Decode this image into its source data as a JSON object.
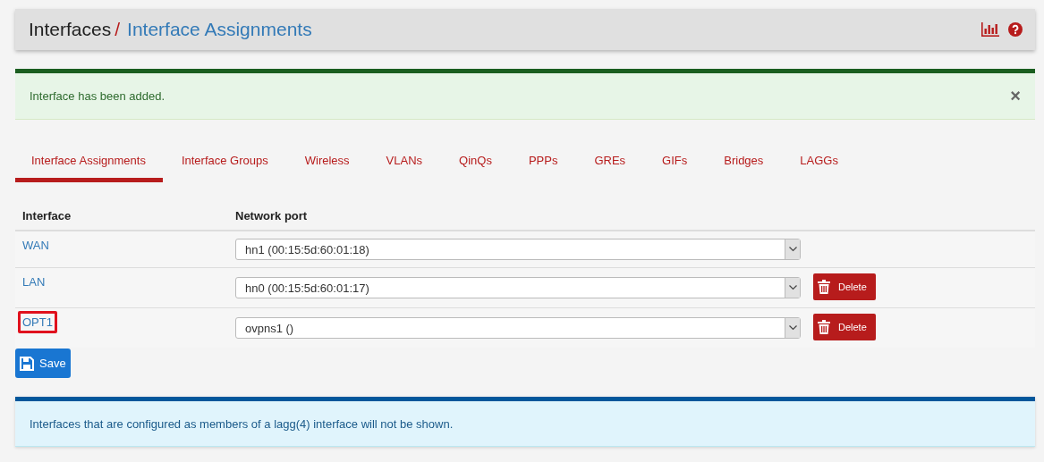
{
  "breadcrumb": {
    "parent": "Interfaces",
    "separator": "/",
    "current": "Interface Assignments"
  },
  "alert": {
    "message": "Interface has been added.",
    "close": "×"
  },
  "tabs": [
    {
      "label": "Interface Assignments",
      "selected": true
    },
    {
      "label": "Interface Groups",
      "selected": false
    },
    {
      "label": "Wireless",
      "selected": false
    },
    {
      "label": "VLANs",
      "selected": false
    },
    {
      "label": "QinQs",
      "selected": false
    },
    {
      "label": "PPPs",
      "selected": false
    },
    {
      "label": "GREs",
      "selected": false
    },
    {
      "label": "GIFs",
      "selected": false
    },
    {
      "label": "Bridges",
      "selected": false
    },
    {
      "label": "LAGGs",
      "selected": false
    }
  ],
  "table": {
    "columns": [
      "Interface",
      "Network port"
    ],
    "rows": [
      {
        "interface": "WAN",
        "port": "hn1 (00:15:5d:60:01:18)",
        "delete": null,
        "highlighted": false
      },
      {
        "interface": "LAN",
        "port": "hn0 (00:15:5d:60:01:17)",
        "delete": "Delete",
        "highlighted": false
      },
      {
        "interface": "OPT1",
        "port": "ovpns1 ()",
        "delete": "Delete",
        "highlighted": true
      }
    ]
  },
  "save_button": "Save",
  "info": "Interfaces that are configured as members of a lagg(4) interface will not be shown."
}
